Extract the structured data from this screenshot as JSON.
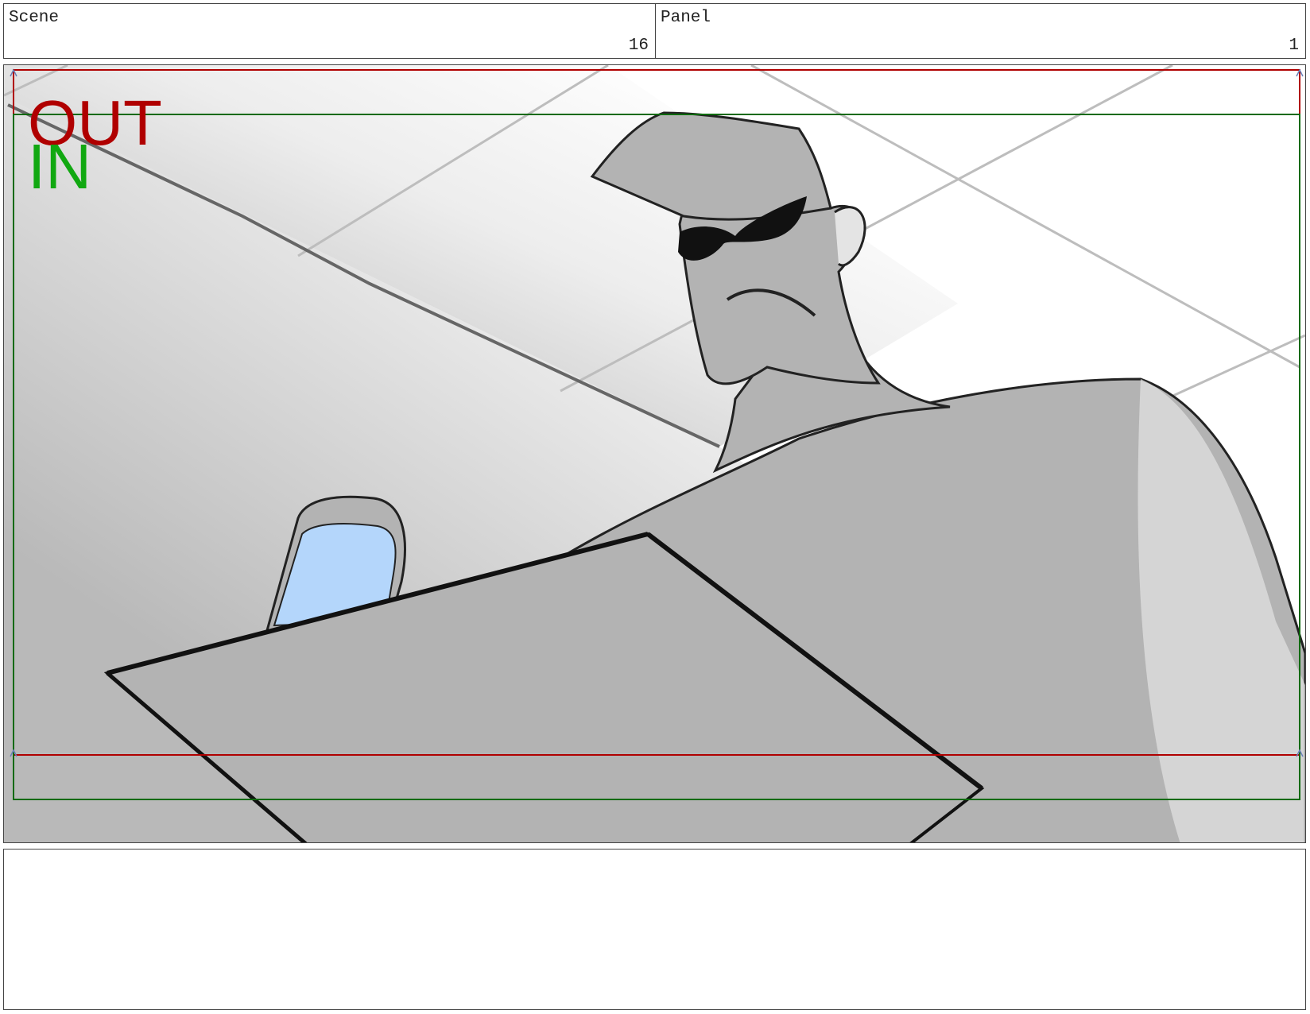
{
  "header": {
    "scene_label": "Scene",
    "scene_value": "16",
    "panel_label": "Panel",
    "panel_value": "1"
  },
  "frame": {
    "out_label": "OUT",
    "in_label": "IN",
    "out_color": "#b00000",
    "in_color": "#11a811",
    "sketch_gray": "#b3b3b3",
    "light_gray": "#e6e6e6",
    "phone_blue": "#b4d6fb"
  },
  "notes": {
    "text": ""
  }
}
